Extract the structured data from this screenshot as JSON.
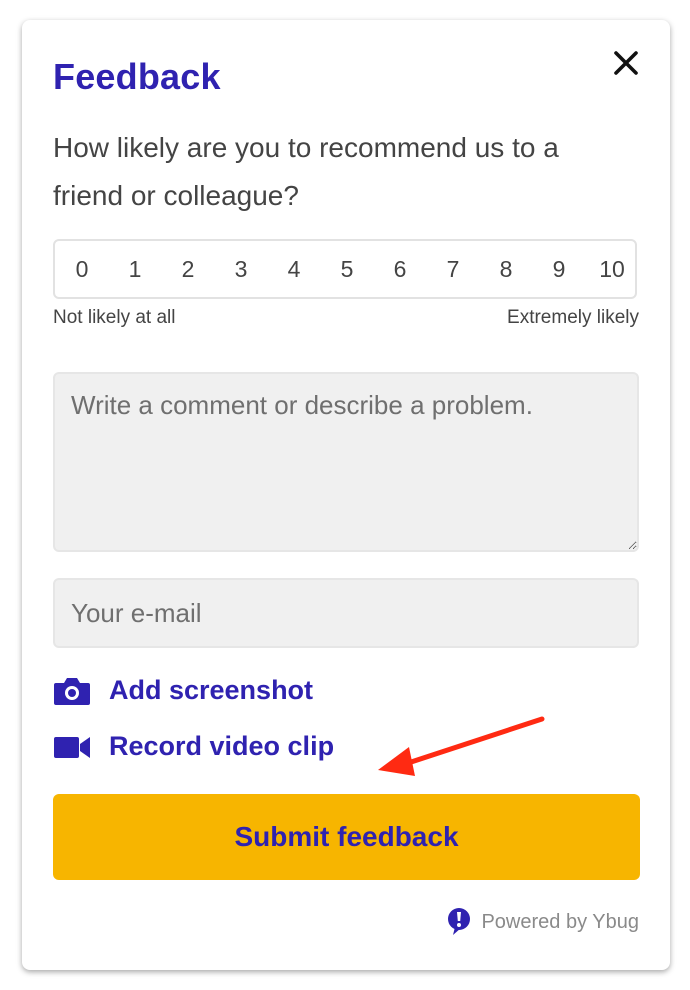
{
  "dialog": {
    "title": "Feedback",
    "close_icon": "close-icon"
  },
  "nps": {
    "question": "How likely are you to recommend us to a friend or colleague?",
    "scale": [
      "0",
      "1",
      "2",
      "3",
      "4",
      "5",
      "6",
      "7",
      "8",
      "9",
      "10"
    ],
    "low_label": "Not likely at all",
    "high_label": "Extremely likely"
  },
  "comment": {
    "placeholder": "Write a comment or describe a problem.",
    "value": ""
  },
  "email": {
    "placeholder": "Your e-mail",
    "value": ""
  },
  "actions": [
    {
      "icon": "camera-icon",
      "label": "Add screenshot"
    },
    {
      "icon": "video-camera-icon",
      "label": "Record video clip"
    }
  ],
  "annotation": {
    "icon": "red-arrow-icon",
    "color": "#ff2a12"
  },
  "submit": {
    "label": "Submit feedback"
  },
  "footer": {
    "icon": "ybug-logo-icon",
    "text": "Powered by Ybug"
  },
  "colors": {
    "accent": "#2f22b0",
    "button": "#f7b500",
    "field_bg": "#f0f0f0"
  }
}
